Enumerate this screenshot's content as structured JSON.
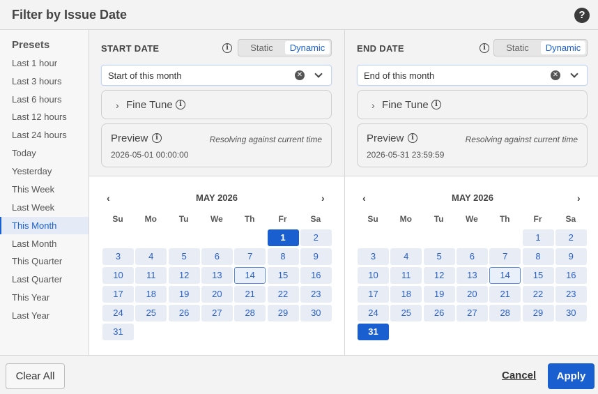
{
  "dialog": {
    "title": "Filter by Issue Date",
    "help_icon": "?"
  },
  "presets": {
    "heading": "Presets",
    "items": [
      "Last 1 hour",
      "Last 3 hours",
      "Last 6 hours",
      "Last 12 hours",
      "Last 24 hours",
      "Today",
      "Yesterday",
      "This Week",
      "Last Week",
      "This Month",
      "Last Month",
      "This Quarter",
      "Last Quarter",
      "This Year",
      "Last Year"
    ],
    "active": "This Month"
  },
  "start": {
    "label": "START DATE",
    "toggle": {
      "static": "Static",
      "dynamic": "Dynamic",
      "selected": "Dynamic"
    },
    "select_value": "Start of this month",
    "fine_tune": "Fine Tune",
    "preview": {
      "title": "Preview",
      "note": "Resolving against current time",
      "value": "2026-05-01 00:00:00"
    },
    "calendar": {
      "month": "MAY 2026",
      "selected_day": "1",
      "today": "14"
    }
  },
  "end": {
    "label": "END DATE",
    "toggle": {
      "static": "Static",
      "dynamic": "Dynamic",
      "selected": "Dynamic"
    },
    "select_value": "End of this month",
    "fine_tune": "Fine Tune",
    "preview": {
      "title": "Preview",
      "note": "Resolving against current time",
      "value": "2026-05-31 23:59:59"
    },
    "calendar": {
      "month": "MAY 2026",
      "selected_day": "31",
      "today": "14"
    }
  },
  "calendar_common": {
    "weekdays": [
      "Su",
      "Mo",
      "Tu",
      "We",
      "Th",
      "Fr",
      "Sa"
    ],
    "prev": "‹",
    "next": "›",
    "days": [
      "1",
      "2",
      "3",
      "4",
      "5",
      "6",
      "7",
      "8",
      "9",
      "10",
      "11",
      "12",
      "13",
      "14",
      "15",
      "16",
      "17",
      "18",
      "19",
      "20",
      "21",
      "22",
      "23",
      "24",
      "25",
      "26",
      "27",
      "28",
      "29",
      "30",
      "31"
    ]
  },
  "footer": {
    "clear_all": "Clear All",
    "cancel": "Cancel",
    "apply": "Apply"
  },
  "colors": {
    "accent": "#1a5fd0",
    "day_bg": "#e7ecf5",
    "panel_bg": "#f3f3f3"
  },
  "icons": [
    "help-circle-icon",
    "info-icon",
    "clear-x-icon",
    "chevron-down-icon",
    "chevron-right-icon",
    "chevron-left-icon"
  ]
}
